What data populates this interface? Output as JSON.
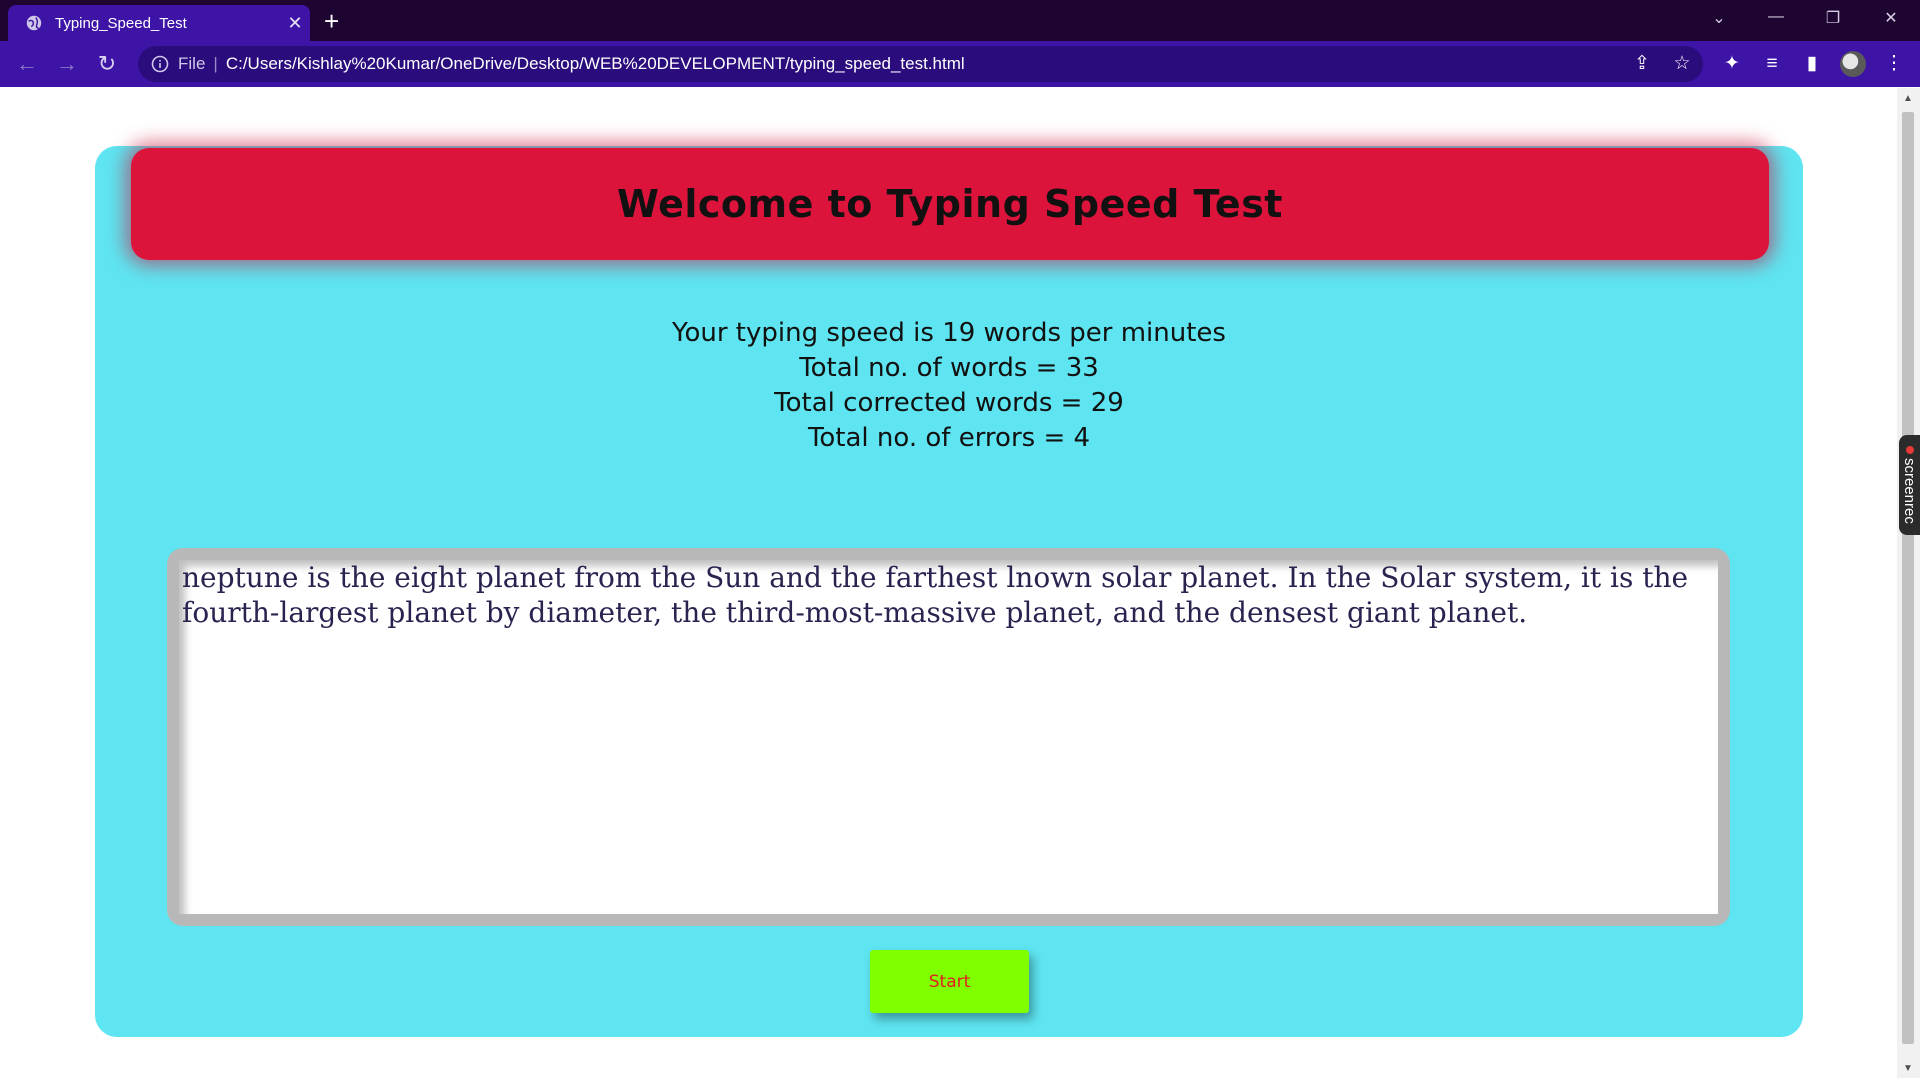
{
  "browser": {
    "tab_title": "Typing_Speed_Test",
    "tab_close": "✕",
    "new_tab": "+",
    "omnibox_scheme": "File",
    "omnibox_separator": "|",
    "url": "C:/Users/Kishlay%20Kumar/OneDrive/Desktop/WEB%20DEVELOPMENT/typing_speed_test.html",
    "window_controls": [
      "⌄",
      "—",
      "❐",
      "✕"
    ],
    "colors": {
      "tabbar": "#1d0431",
      "toolbar": "#3d14a6",
      "omnibox": "#2a0c7d"
    }
  },
  "icons": {
    "back": "←",
    "forward": "→",
    "reload": "↻",
    "info": "ⓘ",
    "share": "⇪",
    "bookmark": "☆",
    "extensions": "✦",
    "media": "≡",
    "sidepanel": "▮",
    "menu": "⋮"
  },
  "overlay": {
    "screenrec_label": "screenrec"
  },
  "page": {
    "header_title": "Welcome to Typing Speed Test",
    "results": {
      "speed_line": "Your typing speed is 19 words per minutes",
      "total_words_line": "Total no. of words = 33",
      "corrected_words_line": "Total corrected words = 29",
      "errors_line": "Total no. of errors = 4"
    },
    "typed_text": "neptune is the eight planet from the Sun and the farthest lnown solar planet. In the Solar system, it is the fourth-largest planet by diameter, the third-most-massive planet, and the densest giant planet.",
    "start_button_label": "Start",
    "colors": {
      "card_bg": "#5ee5f1",
      "header_bg": "#dc143c",
      "start_button_bg": "#7fff00",
      "start_button_text": "#e11d1d"
    }
  }
}
